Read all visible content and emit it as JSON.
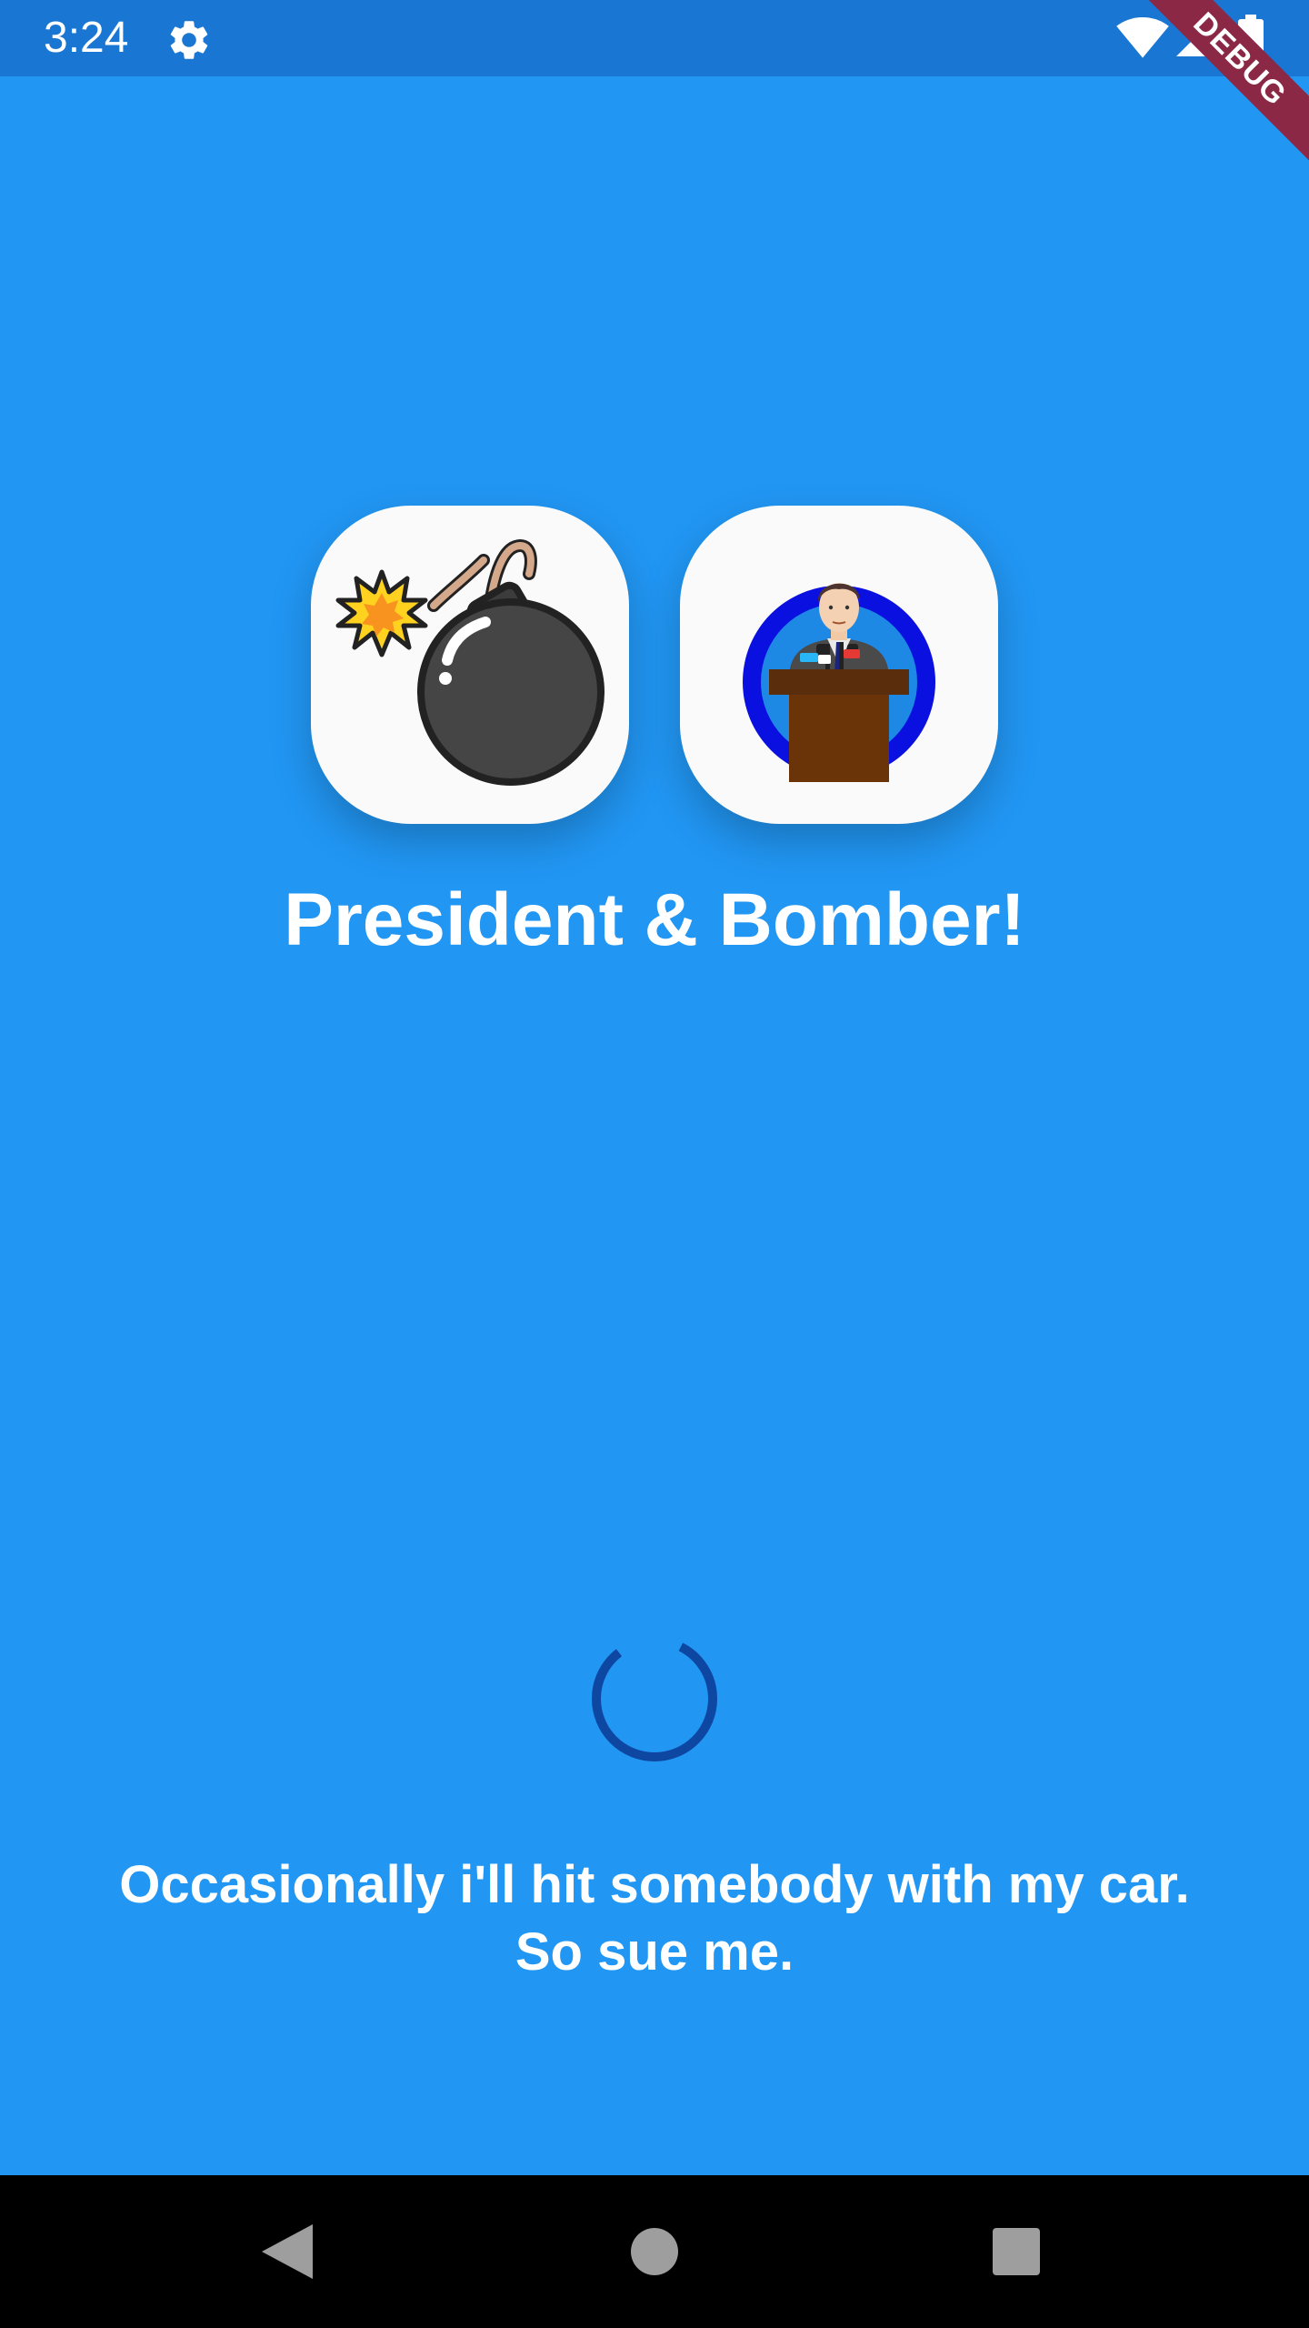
{
  "status_bar": {
    "time": "3:24",
    "icons": [
      "settings-gear-icon",
      "wifi-icon",
      "signal-icon",
      "battery-icon"
    ],
    "background": "#1976D2"
  },
  "debug_banner": {
    "label": "DEBUG",
    "color": "#8B2846"
  },
  "logos": [
    {
      "name": "bomb-icon"
    },
    {
      "name": "president-podium-icon"
    }
  ],
  "app": {
    "title": "President & Bomber!",
    "background": "#2196F3"
  },
  "loading": {
    "indicator": "circular-progress-spinner",
    "color": "#0D47A1"
  },
  "quote": {
    "line1": "Occasionally i'll hit somebody with my car.",
    "line2": "So sue me."
  },
  "nav_bar": {
    "buttons": [
      "back-icon",
      "home-icon",
      "recents-icon"
    ]
  }
}
